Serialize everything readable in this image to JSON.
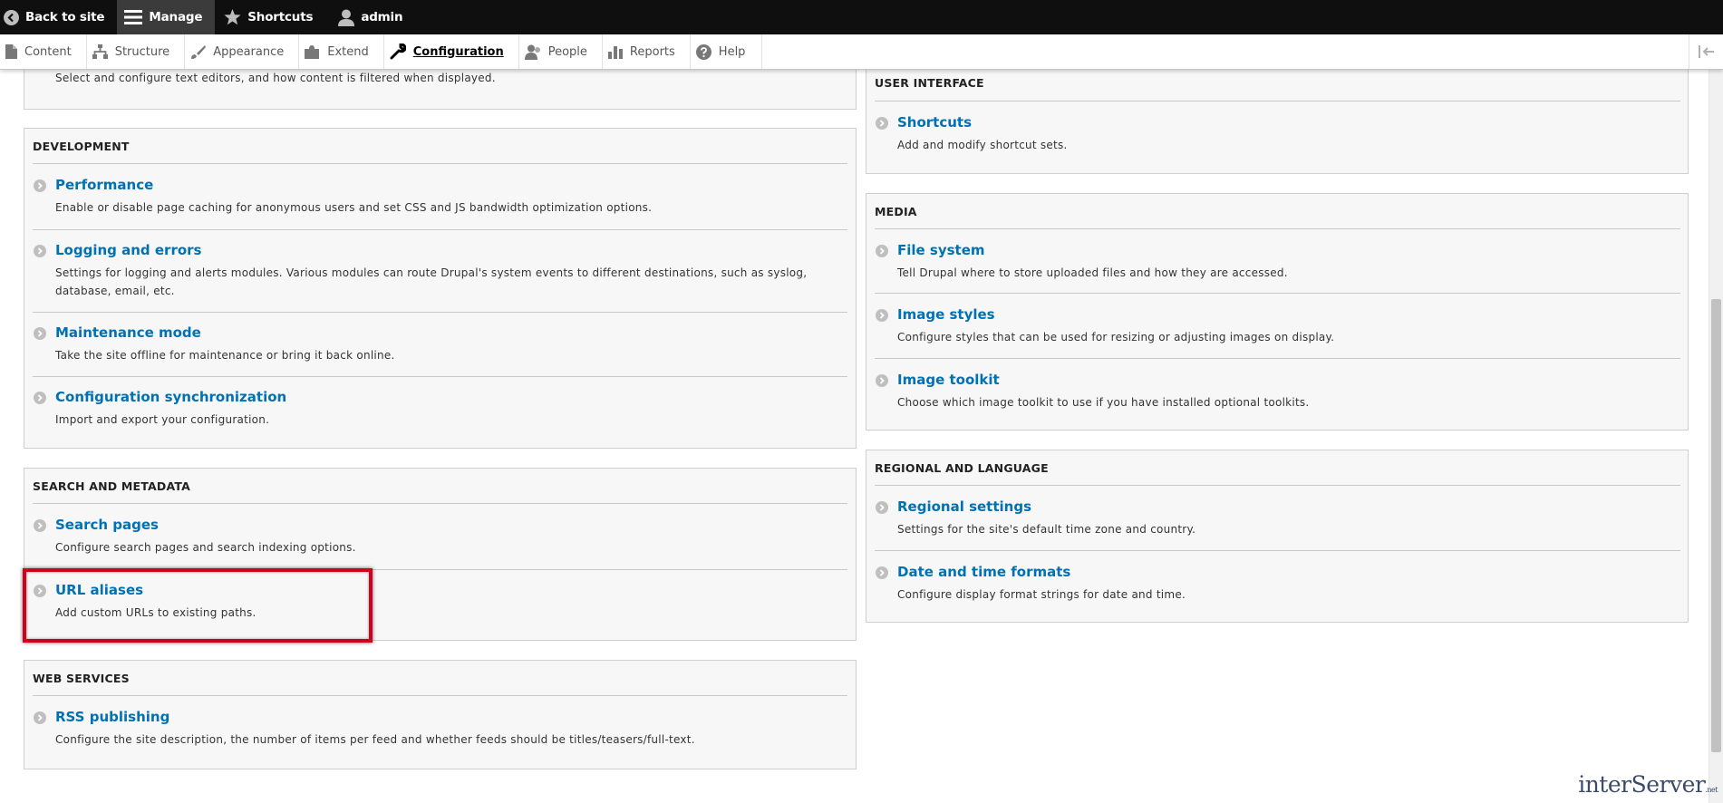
{
  "toolbar": {
    "back_label": "Back to site",
    "manage_label": "Manage",
    "shortcuts_label": "Shortcuts",
    "user_label": "admin"
  },
  "tray": {
    "items": [
      {
        "label": "Content",
        "icon": "file-icon"
      },
      {
        "label": "Structure",
        "icon": "sitemap-icon"
      },
      {
        "label": "Appearance",
        "icon": "paintbrush-icon"
      },
      {
        "label": "Extend",
        "icon": "puzzle-icon"
      },
      {
        "label": "Configuration",
        "icon": "wrench-icon",
        "active": true
      },
      {
        "label": "People",
        "icon": "person-icon"
      },
      {
        "label": "Reports",
        "icon": "bar-chart-icon"
      },
      {
        "label": "Help",
        "icon": "help-icon"
      }
    ]
  },
  "panels": {
    "content_authoring": {
      "partial_desc": "Select and configure text editors, and how content is filtered when displayed."
    },
    "development": {
      "title": "DEVELOPMENT",
      "items": [
        {
          "link": "Performance",
          "desc": "Enable or disable page caching for anonymous users and set CSS and JS bandwidth optimization options."
        },
        {
          "link": "Logging and errors",
          "desc": "Settings for logging and alerts modules. Various modules can route Drupal's system events to different destinations, such as syslog, database, email, etc."
        },
        {
          "link": "Maintenance mode",
          "desc": "Take the site offline for maintenance or bring it back online."
        },
        {
          "link": "Configuration synchronization",
          "desc": "Import and export your configuration."
        }
      ]
    },
    "search_metadata": {
      "title": "SEARCH AND METADATA",
      "items": [
        {
          "link": "Search pages",
          "desc": "Configure search pages and search indexing options."
        },
        {
          "link": "URL aliases",
          "desc": "Add custom URLs to existing paths."
        }
      ]
    },
    "web_services": {
      "title": "WEB SERVICES",
      "items": [
        {
          "link": "RSS publishing",
          "desc": "Configure the site description, the number of items per feed and whether feeds should be titles/teasers/full-text."
        }
      ]
    },
    "user_interface": {
      "title": "USER INTERFACE",
      "items": [
        {
          "link": "Shortcuts",
          "desc": "Add and modify shortcut sets."
        }
      ]
    },
    "media": {
      "title": "MEDIA",
      "items": [
        {
          "link": "File system",
          "desc": "Tell Drupal where to store uploaded files and how they are accessed."
        },
        {
          "link": "Image styles",
          "desc": "Configure styles that can be used for resizing or adjusting images on display."
        },
        {
          "link": "Image toolkit",
          "desc": "Choose which image toolkit to use if you have installed optional toolkits."
        }
      ]
    },
    "regional": {
      "title": "REGIONAL AND LANGUAGE",
      "items": [
        {
          "link": "Regional settings",
          "desc": "Settings for the site's default time zone and country."
        },
        {
          "link": "Date and time formats",
          "desc": "Configure display format strings for date and time."
        }
      ]
    }
  },
  "watermark": {
    "text": "interServer",
    "suffix": ".net"
  },
  "colors": {
    "link": "#0071b3",
    "highlight": "#d0021b",
    "toolbar": "#0f0f0f"
  }
}
